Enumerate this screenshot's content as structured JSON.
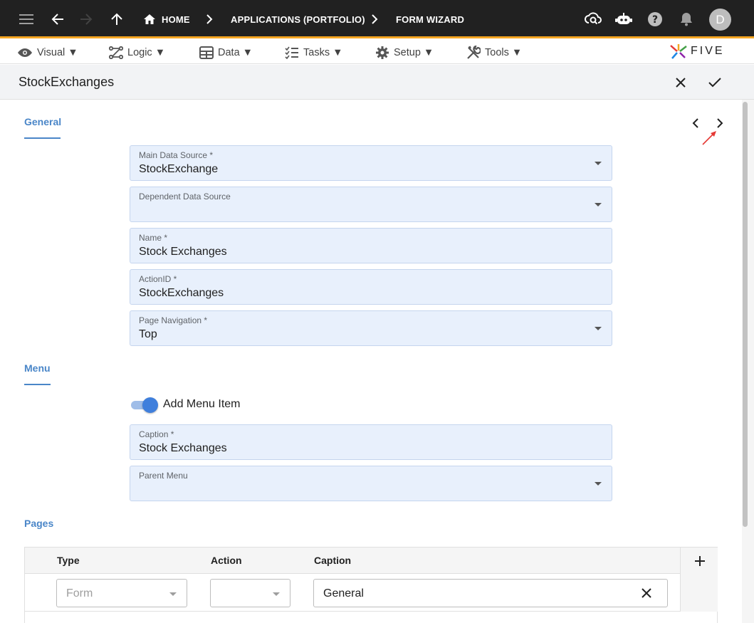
{
  "topbar": {
    "breadcrumbs": [
      "HOME",
      "APPLICATIONS (PORTFOLIO)",
      "FORM WIZARD"
    ],
    "avatar_initial": "D",
    "accent_color": "#f5a623"
  },
  "menubar": {
    "items": [
      {
        "label": "Visual ▼",
        "icon": "eye-icon"
      },
      {
        "label": "Logic ▼",
        "icon": "logic-icon"
      },
      {
        "label": "Data ▼",
        "icon": "table-icon"
      },
      {
        "label": "Tasks ▼",
        "icon": "checklist-icon"
      },
      {
        "label": "Setup ▼",
        "icon": "gear-icon"
      },
      {
        "label": "Tools ▼",
        "icon": "tools-icon"
      }
    ],
    "logo_text": "FIVE"
  },
  "form": {
    "title": "StockExchanges",
    "sections": {
      "general": "General",
      "menu": "Menu",
      "pages": "Pages"
    },
    "fields": {
      "main_data_source": {
        "label": "Main Data Source *",
        "value": "StockExchange"
      },
      "dependent_data_source": {
        "label": "Dependent Data Source",
        "value": ""
      },
      "name": {
        "label": "Name *",
        "value": "Stock Exchanges"
      },
      "action_id": {
        "label": "ActionID *",
        "value": "StockExchanges"
      },
      "page_navigation": {
        "label": "Page Navigation *",
        "value": "Top"
      },
      "caption": {
        "label": "Caption *",
        "value": "Stock Exchanges"
      },
      "parent_menu": {
        "label": "Parent Menu",
        "value": ""
      }
    },
    "add_menu_item": {
      "label": "Add Menu Item",
      "checked": true
    },
    "pages_table": {
      "columns": [
        "Type",
        "Action",
        "Caption"
      ],
      "rows": [
        {
          "type": "Form",
          "action": "",
          "caption": "General"
        }
      ]
    }
  },
  "colors": {
    "field_bg": "#e8f0fc",
    "section_accent": "#4a86c8",
    "annotation_arrow": "#e53935"
  }
}
